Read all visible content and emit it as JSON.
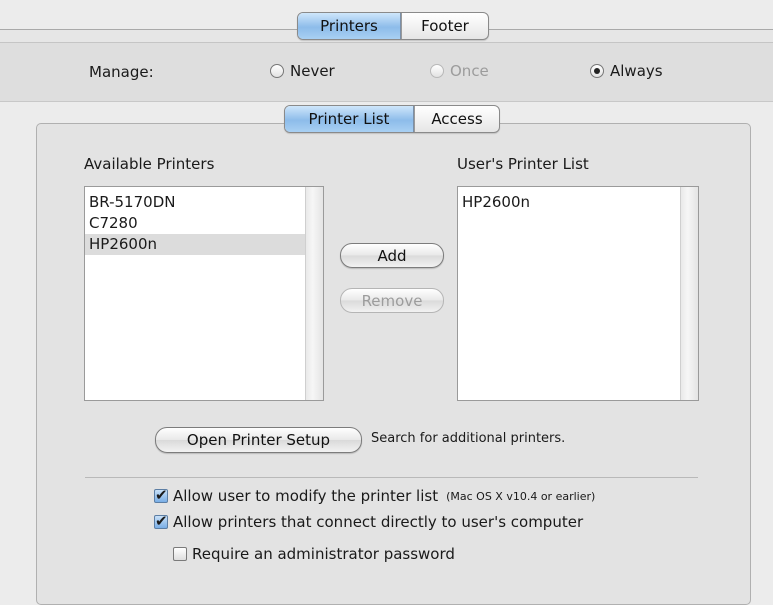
{
  "top_tabs": [
    {
      "label": "Printers",
      "selected": true
    },
    {
      "label": "Footer",
      "selected": false
    }
  ],
  "manage": {
    "label": "Manage:",
    "options": [
      {
        "label": "Never",
        "selected": false,
        "enabled": true
      },
      {
        "label": "Once",
        "selected": false,
        "enabled": false
      },
      {
        "label": "Always",
        "selected": true,
        "enabled": true
      }
    ]
  },
  "inner_tabs": [
    {
      "label": "Printer List",
      "selected": true
    },
    {
      "label": "Access",
      "selected": false
    }
  ],
  "available": {
    "title": "Available Printers",
    "items": [
      "BR-5170DN",
      "C7280",
      "HP2600n"
    ],
    "selected_index": 2
  },
  "user_list": {
    "title": "User's Printer List",
    "items": [
      "HP2600n"
    ]
  },
  "buttons": {
    "add": "Add",
    "remove": "Remove",
    "open_setup": "Open Printer Setup",
    "setup_hint": "Search for additional printers."
  },
  "options": [
    {
      "label": "Allow user to modify the printer list",
      "note": "(Mac OS X v10.4 or earlier)",
      "checked": true
    },
    {
      "label": "Allow printers that connect directly to user's computer",
      "note": "",
      "checked": true
    },
    {
      "label": "Require an administrator password",
      "note": "",
      "checked": false
    }
  ],
  "colors": {
    "selected_tab": "#8dbcea",
    "list_selection": "#dcdcdc",
    "checkbox_checked": "#79aee6"
  }
}
